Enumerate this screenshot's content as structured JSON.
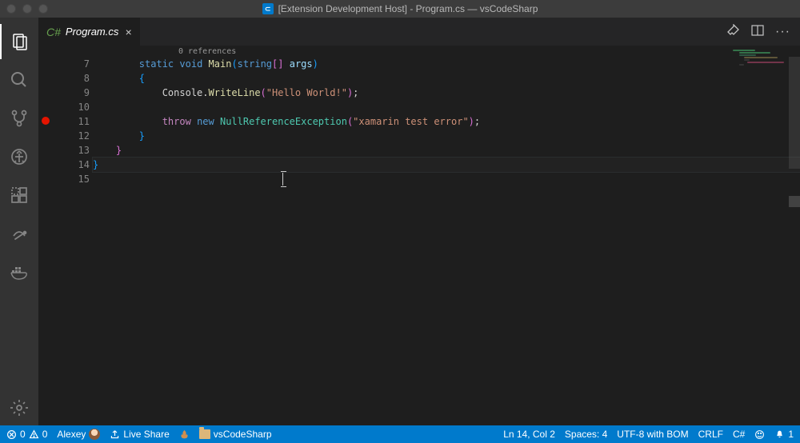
{
  "window": {
    "title": "[Extension Development Host] - Program.cs — vsCodeSharp"
  },
  "tab": {
    "filename": "Program.cs"
  },
  "codelens": {
    "references": "0 references"
  },
  "code": {
    "lineNumbers": [
      "7",
      "8",
      "9",
      "10",
      "11",
      "12",
      "13",
      "14",
      "15"
    ],
    "breakpointLine": 11,
    "staticKw": "static",
    "voidKw": "void",
    "mainFn": "Main",
    "stringType": "string",
    "argsParam": "args",
    "consoleWrite": "Console.WriteLine",
    "hello": "\"Hello World!\"",
    "throwKw": "throw",
    "newKw": "new",
    "nre": "NullReferenceException",
    "errMsg": "\"xamarin test error\"",
    "braceOpen": "{",
    "braceClose": "}",
    "semi": ";",
    "sqOpen": "[",
    "sqClose": "]",
    "parenOpen": "(",
    "parenClose": ")",
    "dot": "."
  },
  "statusbar": {
    "errors": "0",
    "warnings": "0",
    "user": "Alexey",
    "liveShare": "Live Share",
    "project": "vsCodeSharp",
    "lnCol": "Ln 14, Col 2",
    "spaces": "Spaces: 4",
    "encoding": "UTF-8 with BOM",
    "eol": "CRLF",
    "lang": "C#",
    "notifications": "1"
  }
}
